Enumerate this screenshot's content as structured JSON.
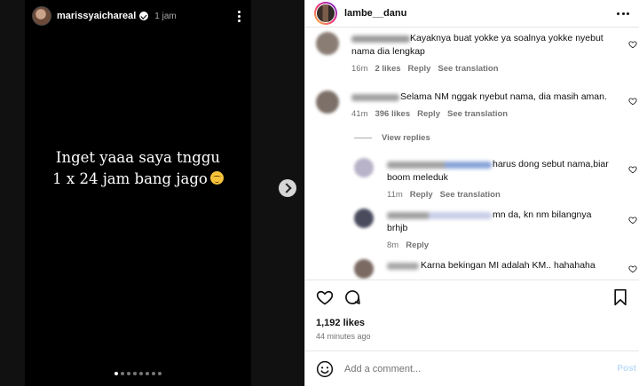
{
  "story": {
    "username": "marissyaichareal",
    "time": "1 jam",
    "text_line1": "Inget yaaa saya tnggu",
    "text_line2": "1 x 24 jam bang jago",
    "progress_dots": 8,
    "active_dot": 0
  },
  "post": {
    "username": "lambe__danu",
    "likes": "1,192 likes",
    "time_ago": "44 minutes ago",
    "add_comment_placeholder": "Add a comment...",
    "post_label": "Post"
  },
  "comments": [
    {
      "text_line1": "Kayaknya buat yokke ya soalnya yokke nyebut",
      "text_line2": "nama dia lengkap",
      "time": "16m",
      "likes": "2 likes",
      "reply": "Reply",
      "translate": "See translation"
    },
    {
      "text_line1": "Selama NM nggak nyebut nama, dia masih aman.",
      "time": "41m",
      "likes": "396 likes",
      "reply": "Reply",
      "translate": "See translation"
    }
  ],
  "view_replies": "View replies",
  "replies": [
    {
      "text_line1": "harus dong sebut nama,biar",
      "text_line2": "boom meleduk",
      "time": "11m",
      "reply": "Reply",
      "translate": "See translation"
    },
    {
      "text_line1": "mn da, kn nm bilangnya",
      "text_line2": "brhjb",
      "time": "8m",
      "reply": "Reply"
    },
    {
      "text_line1": "Karna bekingan MI adalah KM.. hahahaha"
    }
  ],
  "icons": {
    "story_more": "kebab-vertical-icon",
    "next": "chevron-right-icon",
    "post_more": "kebab-horizontal-icon",
    "comment_like": "heart-outline-icon",
    "like": "heart-icon",
    "comment": "comment-bubble-icon",
    "save": "bookmark-icon",
    "emoji": "smiley-icon"
  },
  "colors": {
    "link_muted": "#737373",
    "post_disabled": "#bfdcf7"
  }
}
